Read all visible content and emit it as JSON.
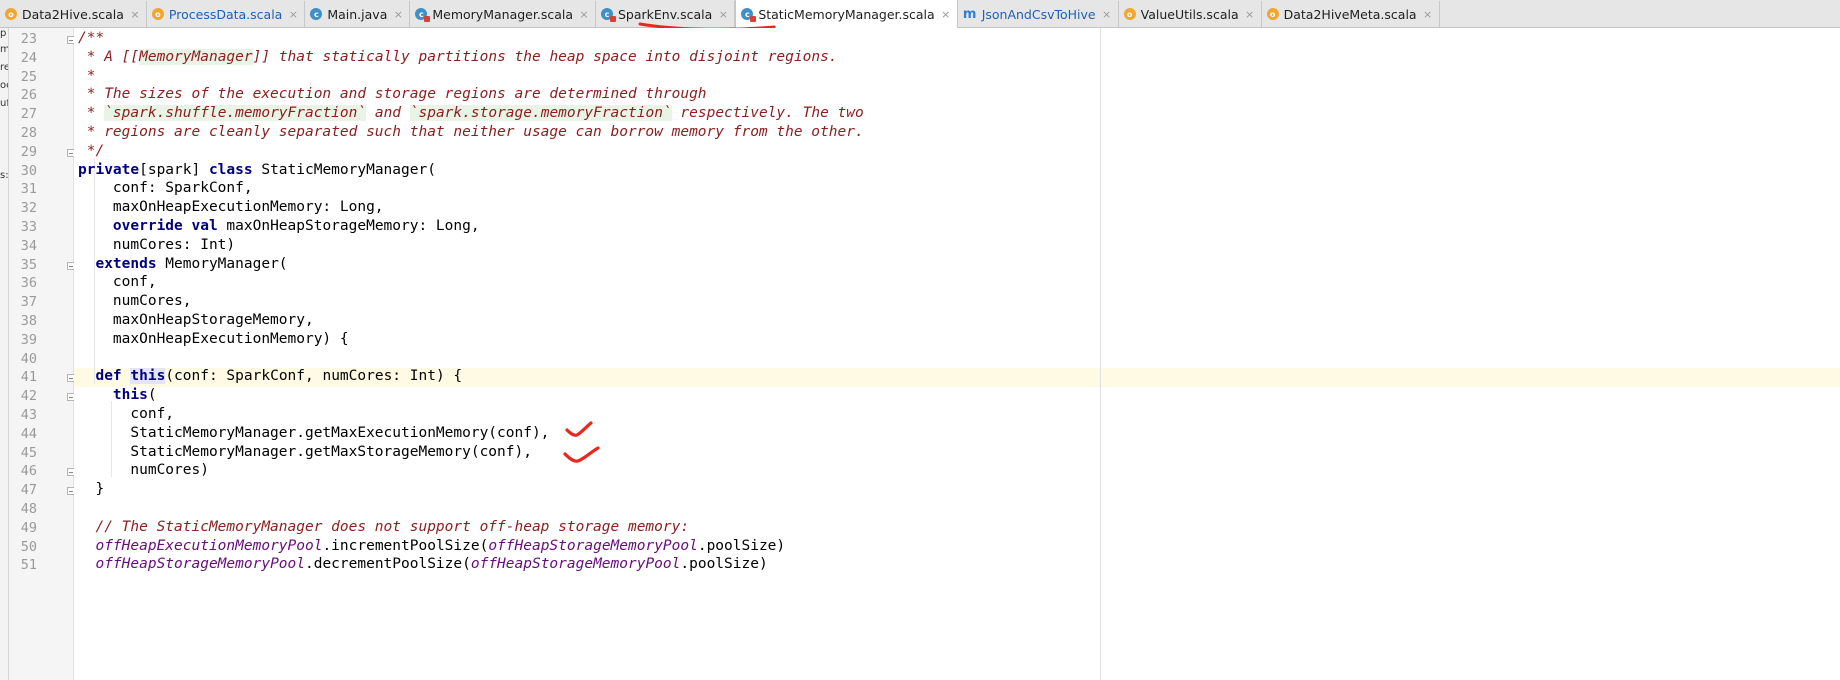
{
  "tabs": [
    {
      "label": "Data2Hive.scala",
      "icon": "scala-object-icon",
      "kind": "obj",
      "blue": false
    },
    {
      "label": "ProcessData.scala",
      "icon": "scala-object-icon",
      "kind": "obj",
      "blue": true
    },
    {
      "label": "Main.java",
      "icon": "java-class-icon",
      "kind": "cls",
      "blue": false
    },
    {
      "label": "MemoryManager.scala",
      "icon": "scala-class-icon",
      "kind": "cls-sc",
      "blue": false
    },
    {
      "label": "SparkEnv.scala",
      "icon": "scala-class-icon",
      "kind": "cls-sc",
      "blue": false
    },
    {
      "label": "StaticMemoryManager.scala",
      "icon": "scala-class-icon",
      "kind": "cls-sc",
      "blue": false,
      "active": true
    },
    {
      "label": "JsonAndCsvToHive",
      "icon": "package-icon",
      "kind": "pkg",
      "blue": true
    },
    {
      "label": "ValueUtils.scala",
      "icon": "scala-object-icon",
      "kind": "obj",
      "blue": false
    },
    {
      "label": "Data2HiveMeta.scala",
      "icon": "scala-object-icon",
      "kind": "obj",
      "blue": false
    }
  ],
  "tab_close_glyph": "×",
  "left_strip_chars": [
    "p",
    "m",
    "re",
    "oc",
    "uf",
    "s:2"
  ],
  "editor": {
    "line_numbers": [
      "23",
      "24",
      "25",
      "26",
      "27",
      "28",
      "29",
      "30",
      "31",
      "32",
      "33",
      "34",
      "35",
      "36",
      "37",
      "38",
      "39",
      "40",
      "41",
      "42",
      "43",
      "44",
      "45",
      "46",
      "47",
      "48",
      "49",
      "50",
      "51"
    ],
    "lines": [
      [
        {
          "t": "/**",
          "c": "doc"
        }
      ],
      [
        {
          "t": " * A ",
          "c": "doc"
        },
        {
          "t": "[[",
          "c": "doc"
        },
        {
          "t": "MemoryManager",
          "c": "doc-ref"
        },
        {
          "t": "]]",
          "c": "doc"
        },
        {
          "t": " that statically partitions the heap space into disjoint regions.",
          "c": "doc"
        }
      ],
      [
        {
          "t": " *",
          "c": "doc"
        }
      ],
      [
        {
          "t": " * The sizes of the execution and storage regions are determined through",
          "c": "doc"
        }
      ],
      [
        {
          "t": " * ",
          "c": "doc"
        },
        {
          "t": "`spark.shuffle.memoryFraction`",
          "c": "doc-ref"
        },
        {
          "t": " and ",
          "c": "doc"
        },
        {
          "t": "`spark.storage.memoryFraction`",
          "c": "doc-ref"
        },
        {
          "t": " respectively. The two",
          "c": "doc"
        }
      ],
      [
        {
          "t": " * regions are cleanly separated such that neither usage can borrow memory from the other.",
          "c": "doc"
        }
      ],
      [
        {
          "t": " */",
          "c": "doc"
        }
      ],
      [
        {
          "t": "private",
          "c": "kw"
        },
        {
          "t": "[spark] ",
          "c": ""
        },
        {
          "t": "class",
          "c": "kw"
        },
        {
          "t": " StaticMemoryManager(",
          "c": ""
        }
      ],
      [
        {
          "t": "    conf: SparkConf,",
          "c": ""
        }
      ],
      [
        {
          "t": "    maxOnHeapExecutionMemory: Long,",
          "c": ""
        }
      ],
      [
        {
          "t": "    ",
          "c": ""
        },
        {
          "t": "override val",
          "c": "kw"
        },
        {
          "t": " maxOnHeapStorageMemory: Long,",
          "c": ""
        }
      ],
      [
        {
          "t": "    numCores: Int)",
          "c": ""
        }
      ],
      [
        {
          "t": "  ",
          "c": ""
        },
        {
          "t": "extends",
          "c": "kw"
        },
        {
          "t": " MemoryManager(",
          "c": ""
        }
      ],
      [
        {
          "t": "    conf,",
          "c": ""
        }
      ],
      [
        {
          "t": "    numCores,",
          "c": ""
        }
      ],
      [
        {
          "t": "    maxOnHeapStorageMemory,",
          "c": ""
        }
      ],
      [
        {
          "t": "    maxOnHeapExecutionMemory) {",
          "c": ""
        }
      ],
      [
        {
          "t": "",
          "c": ""
        }
      ],
      [
        {
          "t": "  ",
          "c": ""
        },
        {
          "t": "def",
          "c": "kw"
        },
        {
          "t": " ",
          "c": ""
        },
        {
          "t": "this",
          "c": "kw thishl"
        },
        {
          "t": "(conf: SparkConf, numCores: Int) {",
          "c": ""
        }
      ],
      [
        {
          "t": "    ",
          "c": ""
        },
        {
          "t": "this",
          "c": "kw"
        },
        {
          "t": "(",
          "c": ""
        }
      ],
      [
        {
          "t": "      conf,",
          "c": ""
        }
      ],
      [
        {
          "t": "      StaticMemoryManager.getMaxExecutionMemory(conf),",
          "c": ""
        }
      ],
      [
        {
          "t": "      StaticMemoryManager.getMaxStorageMemory(conf),",
          "c": ""
        }
      ],
      [
        {
          "t": "      numCores)",
          "c": ""
        }
      ],
      [
        {
          "t": "  }",
          "c": ""
        }
      ],
      [
        {
          "t": "",
          "c": ""
        }
      ],
      [
        {
          "t": "  // The StaticMemoryManager does not support off-heap storage memory:",
          "c": "doc"
        }
      ],
      [
        {
          "t": "  ",
          "c": ""
        },
        {
          "t": "offHeapExecutionMemoryPool",
          "c": "field"
        },
        {
          "t": ".incrementPoolSize(",
          "c": ""
        },
        {
          "t": "offHeapStorageMemoryPool",
          "c": "field"
        },
        {
          "t": ".poolSize)",
          "c": ""
        }
      ],
      [
        {
          "t": "  ",
          "c": ""
        },
        {
          "t": "offHeapStorageMemoryPool",
          "c": "field"
        },
        {
          "t": ".decrementPoolSize(",
          "c": ""
        },
        {
          "t": "offHeapStorageMemoryPool",
          "c": "field"
        },
        {
          "t": ".poolSize)",
          "c": ""
        }
      ]
    ],
    "caret_line": "41"
  },
  "colors": {
    "keyword": "#000080",
    "doc_comment": "#8b1e1e",
    "field": "#660e7a",
    "caret_line_bg": "#fffae3",
    "annotation_red": "#e8281e"
  }
}
